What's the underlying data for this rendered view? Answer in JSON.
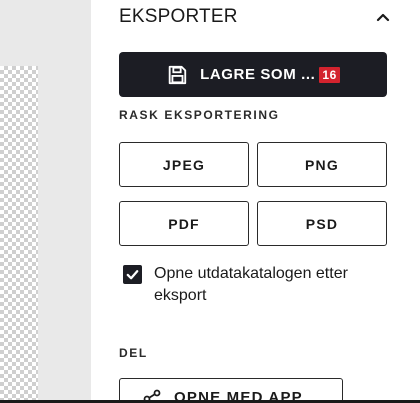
{
  "panel": {
    "title": "EKSPORTER",
    "collapse_icon": "chevron-up-icon"
  },
  "save_as": {
    "label": "LAGRE SOM ...",
    "badge": "16",
    "icon": "floppy-disk-icon"
  },
  "quick_export": {
    "heading": "RASK EKSPORTERING",
    "formats": [
      "JPEG",
      "PNG",
      "PDF",
      "PSD"
    ]
  },
  "open_folder": {
    "checked": true,
    "label": "Opne utdatakatalogen etter eksport"
  },
  "share": {
    "heading": "DEL",
    "open_with_label": "OPNE MED APP",
    "open_with_icon": "share-icon",
    "more_label": "..."
  },
  "colors": {
    "button_dark": "#1c1d24",
    "badge_red": "#d3232e",
    "panel_bg": "#ffffff",
    "canvas_bg": "#e9e9e9"
  }
}
